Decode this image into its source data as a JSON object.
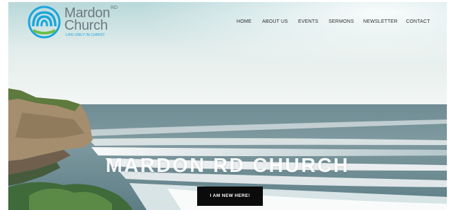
{
  "logo": {
    "name_line1": "Mardon",
    "name_line2": "Church",
    "superscript": "RD",
    "tagline": "LIFE ONLY IN CHRIST"
  },
  "nav": {
    "items": [
      {
        "label": "HOME"
      },
      {
        "label": "ABOUT US"
      },
      {
        "label": "EVENTS"
      },
      {
        "label": "SERMONS"
      },
      {
        "label": "NEWSLETTER"
      },
      {
        "label": "CONTACT"
      }
    ]
  },
  "hero": {
    "title": "MARDON RD CHURCH",
    "cta_label": "I AM NEW HERE!"
  },
  "colors": {
    "brand_blue": "#1aa6dc",
    "brand_green": "#6dbf4a",
    "logo_text": "#6d7a80",
    "cta_background": "#0b0b0b",
    "cta_text": "#ffffff"
  },
  "icons": {
    "logo_mark": "church-arch-logo-icon"
  }
}
